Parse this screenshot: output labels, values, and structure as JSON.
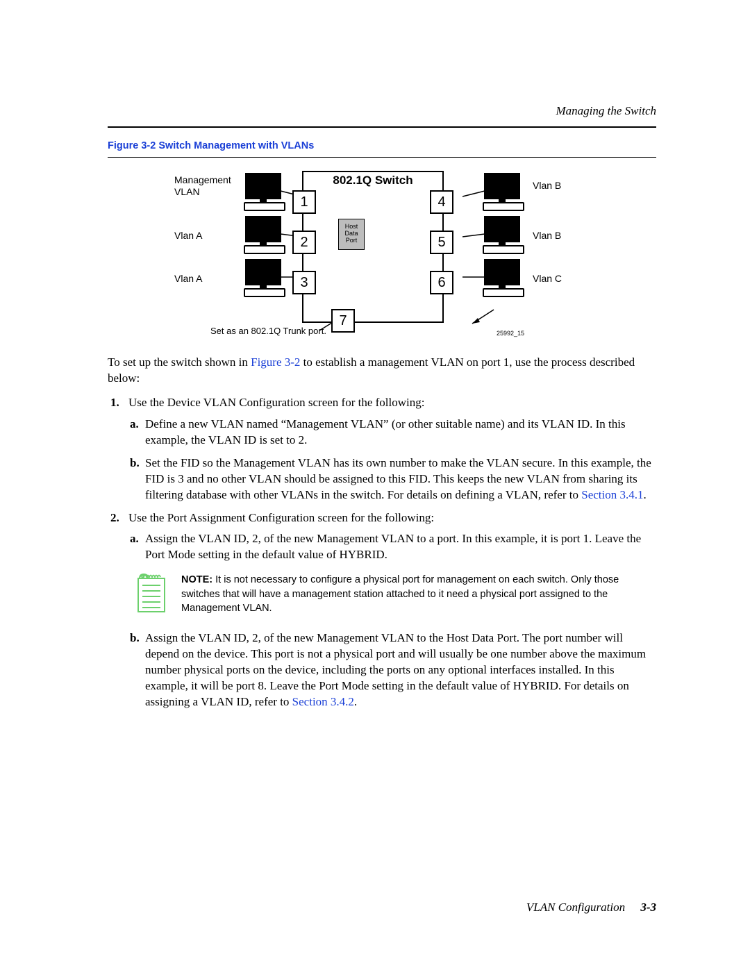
{
  "header": {
    "running": "Managing the Switch"
  },
  "figure": {
    "caption": "Figure 3-2   Switch Management with VLANs",
    "switch_title": "802.1Q Switch",
    "ports": {
      "p1": "1",
      "p2": "2",
      "p3": "3",
      "p4": "4",
      "p5": "5",
      "p6": "6",
      "p7": "7"
    },
    "host_port": "Host\nData\nPort",
    "labels": {
      "mgmt1": "Management",
      "mgmt2": "VLAN",
      "vlan_a": "Vlan A",
      "vlan_b": "Vlan B",
      "vlan_c": "Vlan C",
      "trunk": "Set as an 802.1Q Trunk port.",
      "docnum": "25992_15"
    }
  },
  "body": {
    "intro_a": "To set up the switch shown in ",
    "intro_link": "Figure 3-2",
    "intro_b": " to establish a management VLAN on port 1, use the process described below:",
    "li1": "Use the Device VLAN Configuration screen for the following:",
    "li1a": "Define a new VLAN named “Management VLAN” (or other suitable name) and its VLAN ID. In this example, the VLAN ID is set to 2.",
    "li1b_a": "Set the FID so the Management VLAN has its own number to make the VLAN secure. In this example, the FID is 3 and no other VLAN should be assigned to this FID. This keeps the new VLAN from sharing its filtering database with other VLANs in the switch. For details on defining a VLAN, refer to ",
    "li1b_link": "Section 3.4.1",
    "li1b_b": ".",
    "li2": "Use the Port Assignment Configuration screen for the following:",
    "li2a": "Assign the VLAN ID, 2, of the new Management VLAN to a port. In this example, it is port 1. Leave the Port Mode setting in the default value of HYBRID.",
    "note_label": "NOTE:",
    "note": "  It is not necessary to configure a physical port for management on each switch. Only those switches that will have a management station attached to it need a physical port assigned to the Management VLAN.",
    "li2b_a": "Assign the VLAN ID, 2, of the new Management VLAN to the Host Data Port. The port number will depend on the device. This port is not a physical port and will usually be one number above the maximum number physical ports on the device, including the ports on any optional interfaces installed. In this example, it will be port 8. Leave the Port Mode setting in the default value of HYBRID. For details on assigning a VLAN ID, refer to ",
    "li2b_link": "Section 3.4.2",
    "li2b_b": "."
  },
  "footer": {
    "section": "VLAN Configuration",
    "page": "3-3"
  }
}
